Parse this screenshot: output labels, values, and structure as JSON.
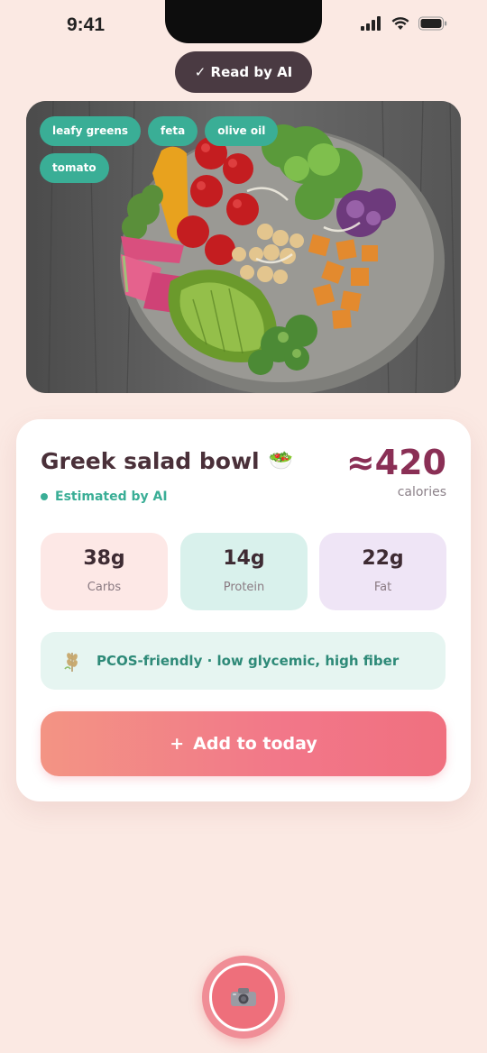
{
  "status_bar": {
    "time": "9:41"
  },
  "badge": {
    "label": "✓ Read by AI"
  },
  "photo": {
    "tags": [
      "leafy greens",
      "feta",
      "olive oil",
      "tomato"
    ]
  },
  "meal": {
    "name": "Greek salad bowl",
    "emoji": "🥗",
    "estimated_label": "Estimated by AI",
    "calories_value": "≈420",
    "calories_label": "calories"
  },
  "macros": [
    {
      "value": "38g",
      "label": "Carbs"
    },
    {
      "value": "14g",
      "label": "Protein"
    },
    {
      "value": "22g",
      "label": "Fat"
    }
  ],
  "note": {
    "text": "PCOS-friendly · low glycemic, high fiber",
    "icon": "wheat-icon"
  },
  "add_button": {
    "plus": "+",
    "label": "Add to today"
  },
  "shutter": {
    "icon": "camera-icon"
  },
  "colors": {
    "accent_teal": "#3aae96",
    "calorie_plum": "#8a2f55",
    "button_coral": "#f27789",
    "background": "#fbe9e3"
  }
}
